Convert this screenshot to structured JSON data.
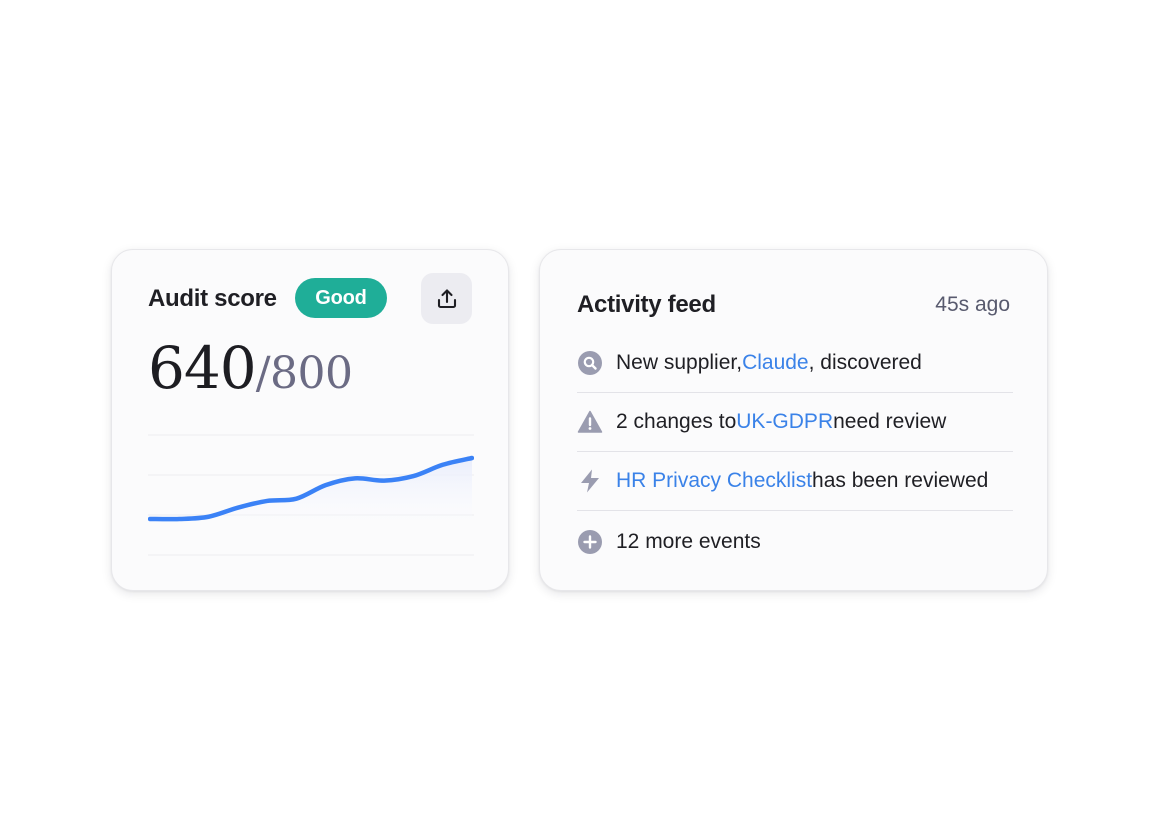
{
  "audit": {
    "title": "Audit score",
    "badge": "Good",
    "share_icon": "upload-share-icon",
    "score": "640",
    "score_max": "/800",
    "trend": {
      "values": [
        0.5,
        0.5,
        0.6,
        1.0,
        1.3,
        1.4,
        2.0,
        2.3,
        2.2,
        2.4,
        2.9,
        3.2
      ],
      "line_color": "#3b82f6",
      "fill_color": "#e9edfc"
    }
  },
  "feed": {
    "title": "Activity feed",
    "time": "45s ago",
    "items": [
      {
        "icon": "search-icon",
        "pre": "New supplier, ",
        "link": "Claude",
        "post": ", discovered"
      },
      {
        "icon": "warning-icon",
        "pre": "2 changes to ",
        "link": "UK-GDPR",
        "post": " need review"
      },
      {
        "icon": "lightning-icon",
        "pre": "",
        "link": "HR Privacy Checklist",
        "post": " has been reviewed"
      },
      {
        "icon": "plus-circle-icon",
        "pre": "12 more events",
        "link": "",
        "post": ""
      }
    ]
  },
  "colors": {
    "badge_bg": "#1fae98",
    "link": "#3a82e8",
    "icon_gray": "#9a9cb0"
  }
}
